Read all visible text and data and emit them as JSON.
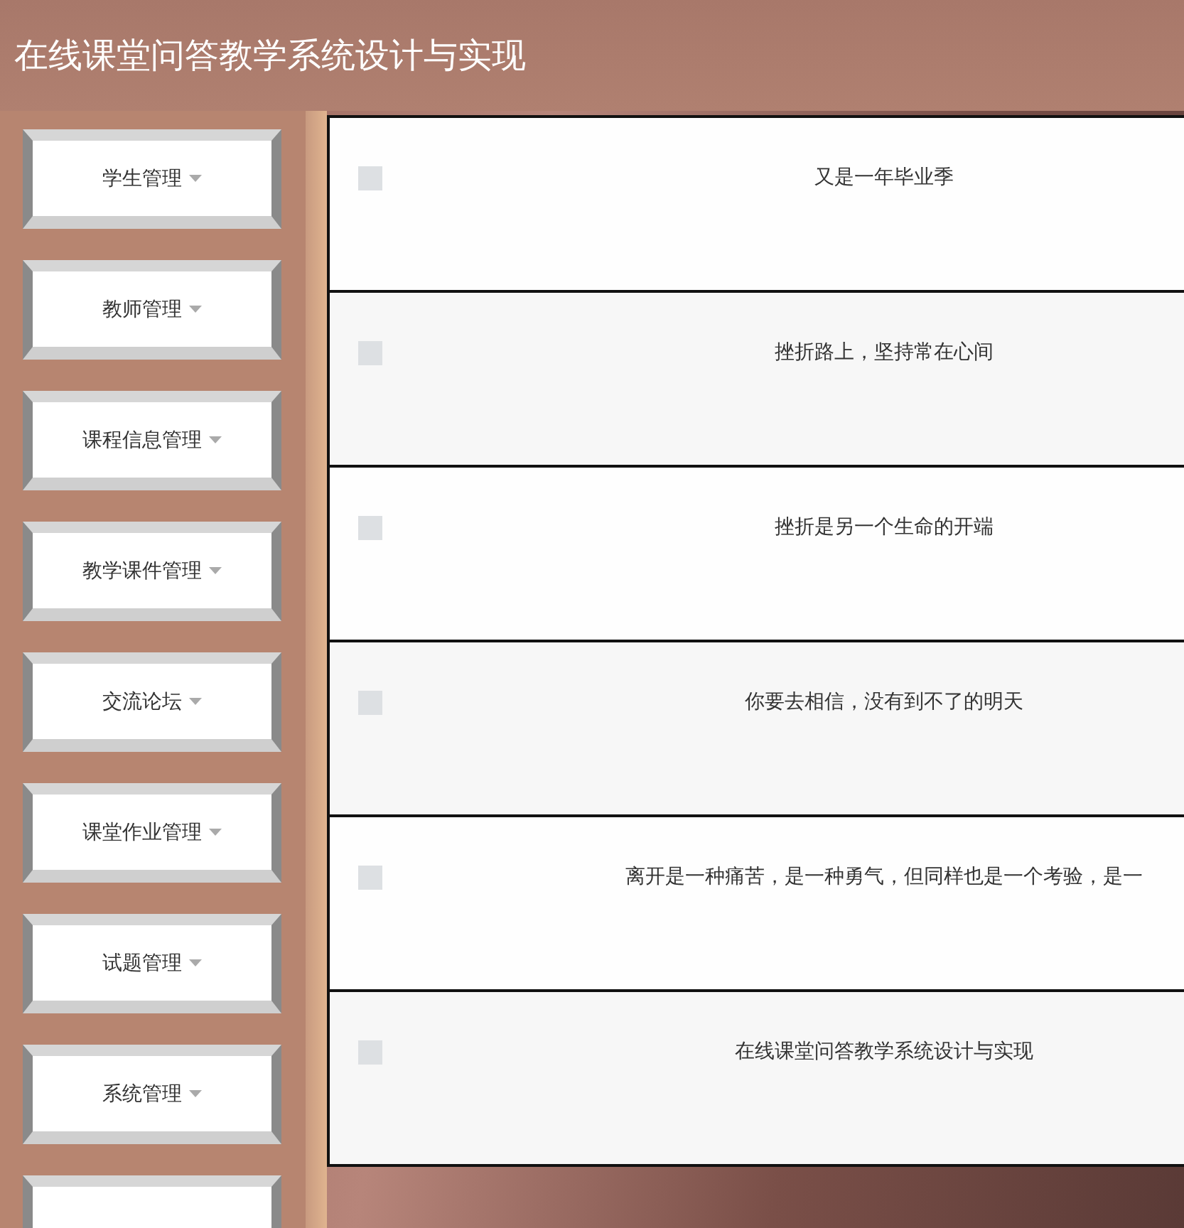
{
  "header": {
    "title": "在线课堂问答教学系统设计与实现"
  },
  "sidebar": {
    "items": [
      {
        "label": "学生管理"
      },
      {
        "label": "教师管理"
      },
      {
        "label": "课程信息管理"
      },
      {
        "label": "教学课件管理"
      },
      {
        "label": "交流论坛"
      },
      {
        "label": "课堂作业管理"
      },
      {
        "label": "试题管理"
      },
      {
        "label": "系统管理"
      }
    ],
    "more_below": true
  },
  "table": {
    "rows": [
      {
        "checked": false,
        "text": "又是一年毕业季"
      },
      {
        "checked": false,
        "text": "挫折路上，坚持常在心间"
      },
      {
        "checked": false,
        "text": "挫折是另一个生命的开端"
      },
      {
        "checked": false,
        "text": "你要去相信，没有到不了的明天"
      },
      {
        "checked": false,
        "text": "离开是一种痛苦，是一种勇气，但同样也是一个考验，是一"
      },
      {
        "checked": false,
        "text": "在线课堂问答教学系统设计与实现"
      }
    ]
  }
}
